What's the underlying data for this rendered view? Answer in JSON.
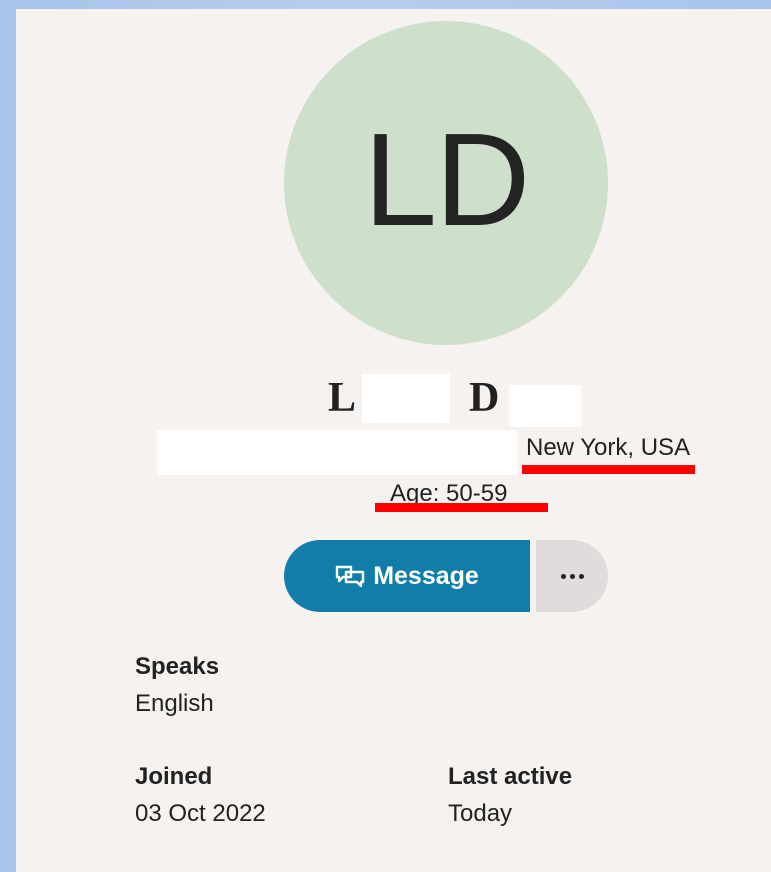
{
  "profile": {
    "initials": "LD",
    "name_first_initial": "L",
    "name_last_initial": "D",
    "location": "New York, USA",
    "age_text": "Age: 50-59"
  },
  "actions": {
    "message_label": "Message",
    "more_icon": "ellipsis-icon",
    "message_icon": "chat-icon"
  },
  "details": {
    "speaks_label": "Speaks",
    "speaks_value": "English",
    "joined_label": "Joined",
    "joined_value": "03 Oct 2022",
    "last_active_label": "Last active",
    "last_active_value": "Today"
  },
  "colors": {
    "page_background": "#f5f2ef",
    "avatar_background": "#cedfcc",
    "primary_button": "#107ea8",
    "secondary_button": "#dfdcdb",
    "annotation_red": "#ff0000",
    "redaction_white": "#ffffff"
  }
}
